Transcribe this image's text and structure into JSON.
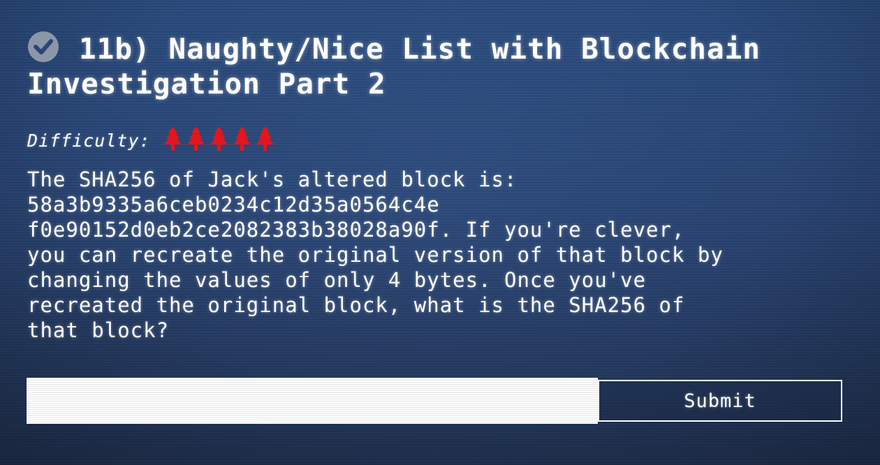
{
  "objective": {
    "title": "11b) Naughty/Nice List with Blockchain Investigation Part 2",
    "completed": true,
    "status_icon": "check-circle-icon",
    "difficulty": {
      "label": "Difficulty:",
      "rating": 5,
      "max_rating": 5,
      "icon": "christmas-tree-icon",
      "icon_color": "#e8141b"
    },
    "question": "The SHA256 of Jack's altered block is:\n58a3b9335a6ceb0234c12d35a0564c4e\nf0e90152d0eb2ce2082383b38028a90f. If you're clever,\nyou can recreate the original version of that block by\nchanging the values of only 4 bytes. Once you've\nrecreated the original block, what is the SHA256 of\nthat block?"
  },
  "answer_form": {
    "input_value": "",
    "submit_label": "Submit"
  },
  "colors": {
    "background_top": "#2c4d7f",
    "background_bottom": "#223454",
    "text": "#ffffff",
    "check_circle": "#8b97a8"
  }
}
